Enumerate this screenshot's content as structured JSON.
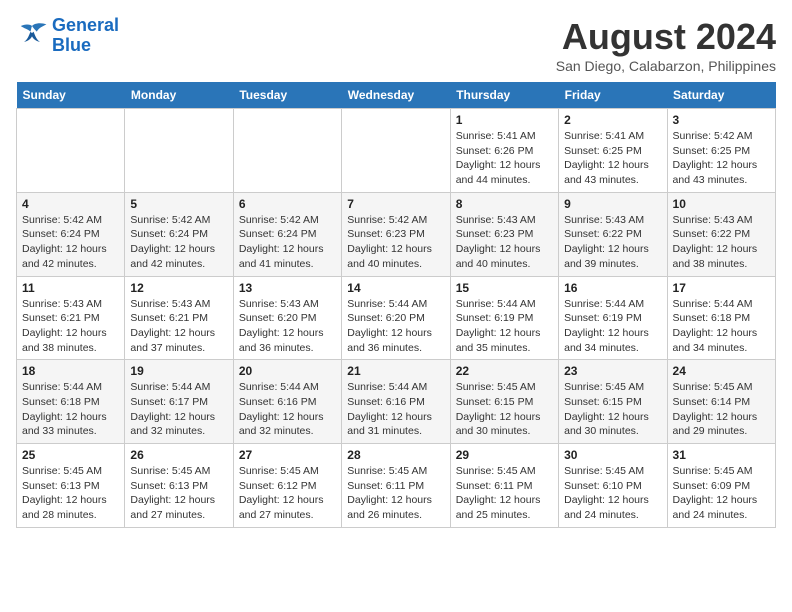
{
  "logo": {
    "line1": "General",
    "line2": "Blue"
  },
  "title": "August 2024",
  "subtitle": "San Diego, Calabarzon, Philippines",
  "days_of_week": [
    "Sunday",
    "Monday",
    "Tuesday",
    "Wednesday",
    "Thursday",
    "Friday",
    "Saturday"
  ],
  "weeks": [
    [
      {
        "day": "",
        "info": ""
      },
      {
        "day": "",
        "info": ""
      },
      {
        "day": "",
        "info": ""
      },
      {
        "day": "",
        "info": ""
      },
      {
        "day": "1",
        "info": "Sunrise: 5:41 AM\nSunset: 6:26 PM\nDaylight: 12 hours and 44 minutes."
      },
      {
        "day": "2",
        "info": "Sunrise: 5:41 AM\nSunset: 6:25 PM\nDaylight: 12 hours and 43 minutes."
      },
      {
        "day": "3",
        "info": "Sunrise: 5:42 AM\nSunset: 6:25 PM\nDaylight: 12 hours and 43 minutes."
      }
    ],
    [
      {
        "day": "4",
        "info": "Sunrise: 5:42 AM\nSunset: 6:24 PM\nDaylight: 12 hours and 42 minutes."
      },
      {
        "day": "5",
        "info": "Sunrise: 5:42 AM\nSunset: 6:24 PM\nDaylight: 12 hours and 42 minutes."
      },
      {
        "day": "6",
        "info": "Sunrise: 5:42 AM\nSunset: 6:24 PM\nDaylight: 12 hours and 41 minutes."
      },
      {
        "day": "7",
        "info": "Sunrise: 5:42 AM\nSunset: 6:23 PM\nDaylight: 12 hours and 40 minutes."
      },
      {
        "day": "8",
        "info": "Sunrise: 5:43 AM\nSunset: 6:23 PM\nDaylight: 12 hours and 40 minutes."
      },
      {
        "day": "9",
        "info": "Sunrise: 5:43 AM\nSunset: 6:22 PM\nDaylight: 12 hours and 39 minutes."
      },
      {
        "day": "10",
        "info": "Sunrise: 5:43 AM\nSunset: 6:22 PM\nDaylight: 12 hours and 38 minutes."
      }
    ],
    [
      {
        "day": "11",
        "info": "Sunrise: 5:43 AM\nSunset: 6:21 PM\nDaylight: 12 hours and 38 minutes."
      },
      {
        "day": "12",
        "info": "Sunrise: 5:43 AM\nSunset: 6:21 PM\nDaylight: 12 hours and 37 minutes."
      },
      {
        "day": "13",
        "info": "Sunrise: 5:43 AM\nSunset: 6:20 PM\nDaylight: 12 hours and 36 minutes."
      },
      {
        "day": "14",
        "info": "Sunrise: 5:44 AM\nSunset: 6:20 PM\nDaylight: 12 hours and 36 minutes."
      },
      {
        "day": "15",
        "info": "Sunrise: 5:44 AM\nSunset: 6:19 PM\nDaylight: 12 hours and 35 minutes."
      },
      {
        "day": "16",
        "info": "Sunrise: 5:44 AM\nSunset: 6:19 PM\nDaylight: 12 hours and 34 minutes."
      },
      {
        "day": "17",
        "info": "Sunrise: 5:44 AM\nSunset: 6:18 PM\nDaylight: 12 hours and 34 minutes."
      }
    ],
    [
      {
        "day": "18",
        "info": "Sunrise: 5:44 AM\nSunset: 6:18 PM\nDaylight: 12 hours and 33 minutes."
      },
      {
        "day": "19",
        "info": "Sunrise: 5:44 AM\nSunset: 6:17 PM\nDaylight: 12 hours and 32 minutes."
      },
      {
        "day": "20",
        "info": "Sunrise: 5:44 AM\nSunset: 6:16 PM\nDaylight: 12 hours and 32 minutes."
      },
      {
        "day": "21",
        "info": "Sunrise: 5:44 AM\nSunset: 6:16 PM\nDaylight: 12 hours and 31 minutes."
      },
      {
        "day": "22",
        "info": "Sunrise: 5:45 AM\nSunset: 6:15 PM\nDaylight: 12 hours and 30 minutes."
      },
      {
        "day": "23",
        "info": "Sunrise: 5:45 AM\nSunset: 6:15 PM\nDaylight: 12 hours and 30 minutes."
      },
      {
        "day": "24",
        "info": "Sunrise: 5:45 AM\nSunset: 6:14 PM\nDaylight: 12 hours and 29 minutes."
      }
    ],
    [
      {
        "day": "25",
        "info": "Sunrise: 5:45 AM\nSunset: 6:13 PM\nDaylight: 12 hours and 28 minutes."
      },
      {
        "day": "26",
        "info": "Sunrise: 5:45 AM\nSunset: 6:13 PM\nDaylight: 12 hours and 27 minutes."
      },
      {
        "day": "27",
        "info": "Sunrise: 5:45 AM\nSunset: 6:12 PM\nDaylight: 12 hours and 27 minutes."
      },
      {
        "day": "28",
        "info": "Sunrise: 5:45 AM\nSunset: 6:11 PM\nDaylight: 12 hours and 26 minutes."
      },
      {
        "day": "29",
        "info": "Sunrise: 5:45 AM\nSunset: 6:11 PM\nDaylight: 12 hours and 25 minutes."
      },
      {
        "day": "30",
        "info": "Sunrise: 5:45 AM\nSunset: 6:10 PM\nDaylight: 12 hours and 24 minutes."
      },
      {
        "day": "31",
        "info": "Sunrise: 5:45 AM\nSunset: 6:09 PM\nDaylight: 12 hours and 24 minutes."
      }
    ]
  ]
}
